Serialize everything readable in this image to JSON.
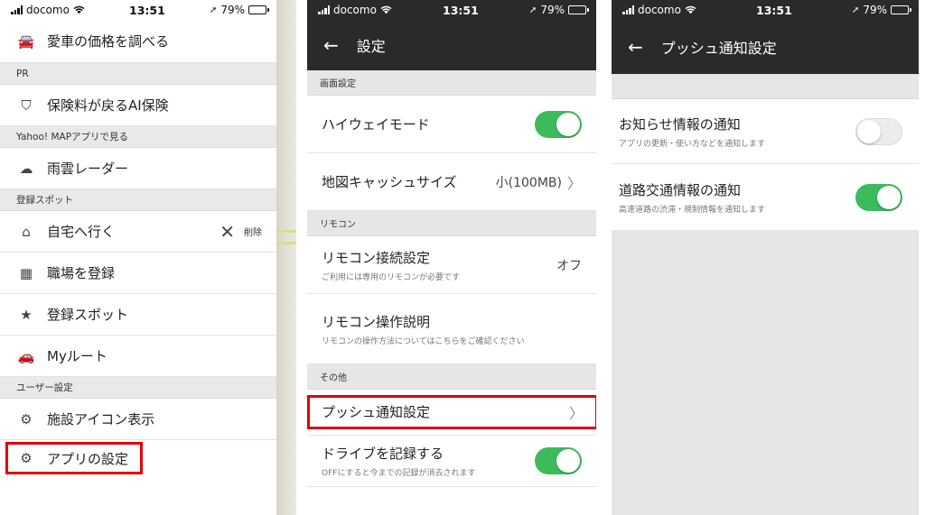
{
  "status": {
    "carrier": "docomo",
    "time": "13:51",
    "battery": "79%"
  },
  "menu": {
    "top_item": "愛車の価格を調べる",
    "pr_header": "PR",
    "pr_item": "保険料が戻るAI保険",
    "yahoo_header": "Yahoo! MAPアプリで見る",
    "rain_item": "雨雲レーダー",
    "spots_header": "登録スポット",
    "home_item": "自宅へ行く",
    "delete_label": "削除",
    "work_item": "職場を登録",
    "spot_item": "登録スポット",
    "route_item": "Myルート",
    "user_header": "ユーザー設定",
    "facility_item": "施設アイコン表示",
    "app_settings_item": "アプリの設定"
  },
  "settings": {
    "title": "設定",
    "screen_header": "画面設定",
    "highway_label": "ハイウェイモード",
    "highway_on": true,
    "cache_label": "地図キャッシュサイズ",
    "cache_value": "小(100MB)",
    "remote_header": "リモコン",
    "remote_conn_label": "リモコン接続設定",
    "remote_conn_sub": "ご利用には専用のリモコンが必要です",
    "remote_conn_value": "オフ",
    "remote_help_label": "リモコン操作説明",
    "remote_help_sub": "リモコンの操作方法についてはこちらをご確認ください",
    "other_header": "その他",
    "push_label": "プッシュ通知設定",
    "drive_label": "ドライブを記録する",
    "drive_sub": "OFFにすると今までの記録が消去されます",
    "drive_on": true
  },
  "push": {
    "title": "プッシュ通知設定",
    "news_label": "お知らせ情報の通知",
    "news_sub": "アプリの更新・使い方などを通知します",
    "news_on": false,
    "traffic_label": "道路交通情報の通知",
    "traffic_sub": "高速道路の渋滞・規制情報を通知します",
    "traffic_on": true
  },
  "colors": {
    "toggle_on": "#3bbb5a",
    "appbar": "#2a2a2a",
    "highlight": "#e00000",
    "accent_orange": "#f07a2a"
  }
}
